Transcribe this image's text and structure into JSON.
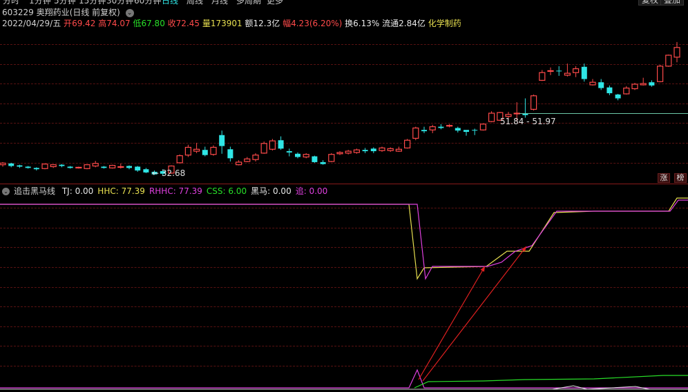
{
  "periods": [
    "分时",
    "1分钟",
    "5分钟",
    "15分钟",
    "30分钟",
    "60分钟",
    "日线",
    "周线",
    "月线",
    "多周期",
    "更多"
  ],
  "active_period": "日线",
  "top_buttons": [
    "复权",
    "叠加"
  ],
  "stock": {
    "code": "603229",
    "name": "奥翔药业",
    "mode": "(日线 前复权)"
  },
  "quote": {
    "date": "2022/04/29/五",
    "open_label": "开",
    "open": "69.42",
    "high_label": "高",
    "high": "74.07",
    "low_label": "低",
    "low": "67.80",
    "close_label": "收",
    "close": "72.45",
    "vol_label": "量",
    "vol": "173901",
    "amt_label": "额",
    "amt": "12.3亿",
    "chg_label": "幅",
    "chg": "4.23(6.20%)",
    "turn_label": "换",
    "turn": "6.13%",
    "float_label": "流通",
    "float": "2.84亿",
    "sector": "化学制药"
  },
  "annotations": {
    "low_mark": "32.68",
    "range_mark": "51.84 - 51.97"
  },
  "side_tags": [
    "涨",
    "榜"
  ],
  "indicator": {
    "name": "追击黑马线",
    "items": [
      {
        "label": "TJ: ",
        "value": "0.00",
        "color": "#e8e8e8"
      },
      {
        "label": "HHC: ",
        "value": "77.39",
        "color": "#e8e050"
      },
      {
        "label": "RHHC: ",
        "value": "77.39",
        "color": "#e040e0"
      },
      {
        "label": "CSS: ",
        "value": "6.00",
        "color": "#28e028"
      },
      {
        "label": "黑马: ",
        "value": "0.00",
        "color": "#e8e8e8"
      },
      {
        "label": "追: ",
        "value": "0.00",
        "color": "#e040e0"
      }
    ]
  },
  "colors": {
    "up": "#ff4a4a",
    "down": "#2fe6e6",
    "bg": "#000000",
    "grid": "#5a1212"
  },
  "chart_data": {
    "type": "candlestick",
    "candles": [
      [
        36.0,
        36.5,
        35.4,
        36.8
      ],
      [
        36.4,
        35.6,
        35.2,
        36.6
      ],
      [
        35.8,
        35.4,
        35.0,
        36.0
      ],
      [
        35.4,
        35.0,
        34.8,
        35.6
      ],
      [
        35.0,
        34.6,
        34.2,
        35.2
      ],
      [
        34.8,
        36.2,
        34.6,
        36.4
      ],
      [
        35.4,
        36.0,
        35.0,
        36.2
      ],
      [
        36.0,
        35.6,
        35.2,
        36.2
      ],
      [
        35.4,
        35.0,
        34.8,
        35.6
      ],
      [
        35.0,
        35.2,
        34.8,
        35.4
      ],
      [
        34.8,
        36.0,
        34.6,
        36.2
      ],
      [
        35.6,
        36.4,
        35.2,
        37.2
      ],
      [
        35.4,
        35.0,
        34.8,
        35.6
      ],
      [
        35.0,
        35.8,
        34.8,
        36.0
      ],
      [
        35.2,
        35.4,
        34.8,
        36.4
      ],
      [
        35.6,
        35.0,
        34.6,
        35.8
      ],
      [
        35.4,
        34.2,
        33.8,
        35.6
      ],
      [
        34.6,
        33.6,
        33.4,
        35.0
      ],
      [
        33.8,
        33.0,
        32.9,
        34.2
      ],
      [
        34.0,
        33.2,
        32.7,
        34.6
      ],
      [
        33.4,
        35.6,
        33.2,
        35.8
      ],
      [
        36.6,
        38.8,
        36.4,
        39.2
      ],
      [
        39.0,
        41.4,
        38.4,
        42.2
      ],
      [
        40.2,
        40.8,
        39.6,
        42.8
      ],
      [
        40.6,
        39.0,
        38.6,
        41.6
      ],
      [
        39.2,
        41.4,
        38.8,
        42.0
      ],
      [
        45.2,
        41.8,
        39.4,
        46.6
      ],
      [
        40.8,
        38.0,
        37.0,
        41.6
      ],
      [
        36.0,
        36.8,
        35.8,
        37.4
      ],
      [
        37.0,
        37.8,
        36.8,
        38.4
      ],
      [
        37.6,
        39.0,
        37.0,
        39.6
      ],
      [
        39.6,
        42.6,
        39.4,
        43.2
      ],
      [
        40.8,
        43.4,
        40.4,
        44.0
      ],
      [
        43.6,
        41.0,
        40.6,
        44.8
      ],
      [
        40.2,
        39.8,
        38.6,
        41.0
      ],
      [
        39.4,
        38.4,
        38.0,
        39.8
      ],
      [
        38.4,
        39.2,
        38.0,
        39.6
      ],
      [
        38.6,
        36.8,
        36.6,
        38.8
      ],
      [
        36.8,
        36.2,
        36.0,
        37.4
      ],
      [
        37.0,
        39.2,
        36.8,
        39.6
      ],
      [
        39.4,
        39.8,
        39.0,
        40.2
      ],
      [
        39.6,
        40.2,
        39.2,
        40.6
      ],
      [
        39.8,
        40.6,
        39.4,
        41.0
      ],
      [
        40.6,
        40.2,
        39.6,
        41.2
      ],
      [
        41.0,
        40.2,
        39.6,
        41.4
      ],
      [
        40.4,
        41.2,
        40.0,
        41.6
      ],
      [
        40.4,
        41.0,
        40.0,
        41.4
      ],
      [
        40.2,
        40.8,
        40.0,
        41.6
      ],
      [
        41.2,
        43.6,
        41.0,
        44.0
      ],
      [
        44.2,
        47.4,
        43.6,
        47.8
      ],
      [
        46.8,
        46.4,
        45.8,
        47.8
      ],
      [
        46.8,
        47.8,
        45.8,
        48.4
      ],
      [
        47.8,
        47.4,
        47.0,
        48.6
      ],
      [
        48.0,
        48.2,
        47.6,
        48.6
      ],
      [
        47.4,
        46.6,
        46.0,
        47.8
      ],
      [
        46.8,
        46.2,
        45.0,
        46.6
      ],
      [
        46.8,
        46.6,
        45.2,
        47.2
      ],
      [
        46.8,
        48.6,
        46.6,
        48.8
      ],
      [
        49.4,
        52.0,
        49.2,
        52.6
      ],
      [
        49.8,
        52.2,
        49.6,
        52.4
      ],
      [
        51.0,
        51.6,
        50.4,
        52.4
      ],
      [
        51.8,
        52.0,
        49.4,
        55.4
      ],
      [
        52.0,
        51.4,
        50.6,
        56.6
      ],
      [
        53.2,
        57.4,
        52.8,
        57.8
      ],
      [
        62.2,
        64.6,
        62.0,
        65.4
      ],
      [
        65.0,
        65.2,
        63.8,
        66.2
      ],
      [
        65.2,
        65.0,
        63.6,
        66.6
      ],
      [
        63.8,
        64.4,
        63.4,
        67.4
      ],
      [
        64.6,
        65.8,
        63.2,
        66.6
      ],
      [
        66.4,
        62.6,
        61.8,
        67.4
      ],
      [
        60.8,
        61.6,
        60.6,
        62.6
      ],
      [
        61.6,
        59.8,
        59.2,
        62.6
      ],
      [
        60.0,
        58.2,
        57.6,
        60.6
      ],
      [
        57.8,
        56.6,
        56.0,
        58.0
      ],
      [
        58.0,
        59.8,
        57.8,
        60.4
      ],
      [
        59.6,
        61.0,
        59.2,
        61.4
      ],
      [
        60.8,
        61.2,
        60.6,
        63.0
      ],
      [
        61.6,
        60.6,
        60.2,
        62.2
      ],
      [
        61.8,
        66.6,
        61.6,
        67.0
      ],
      [
        66.6,
        70.0,
        66.4,
        70.2
      ],
      [
        69.4,
        72.4,
        67.8,
        74.1
      ]
    ],
    "hline": 51.9,
    "indicator_series": {
      "HHC": "flat high then drop, stepping up to 77.39",
      "RHHC": "follows HHC with lag"
    }
  }
}
